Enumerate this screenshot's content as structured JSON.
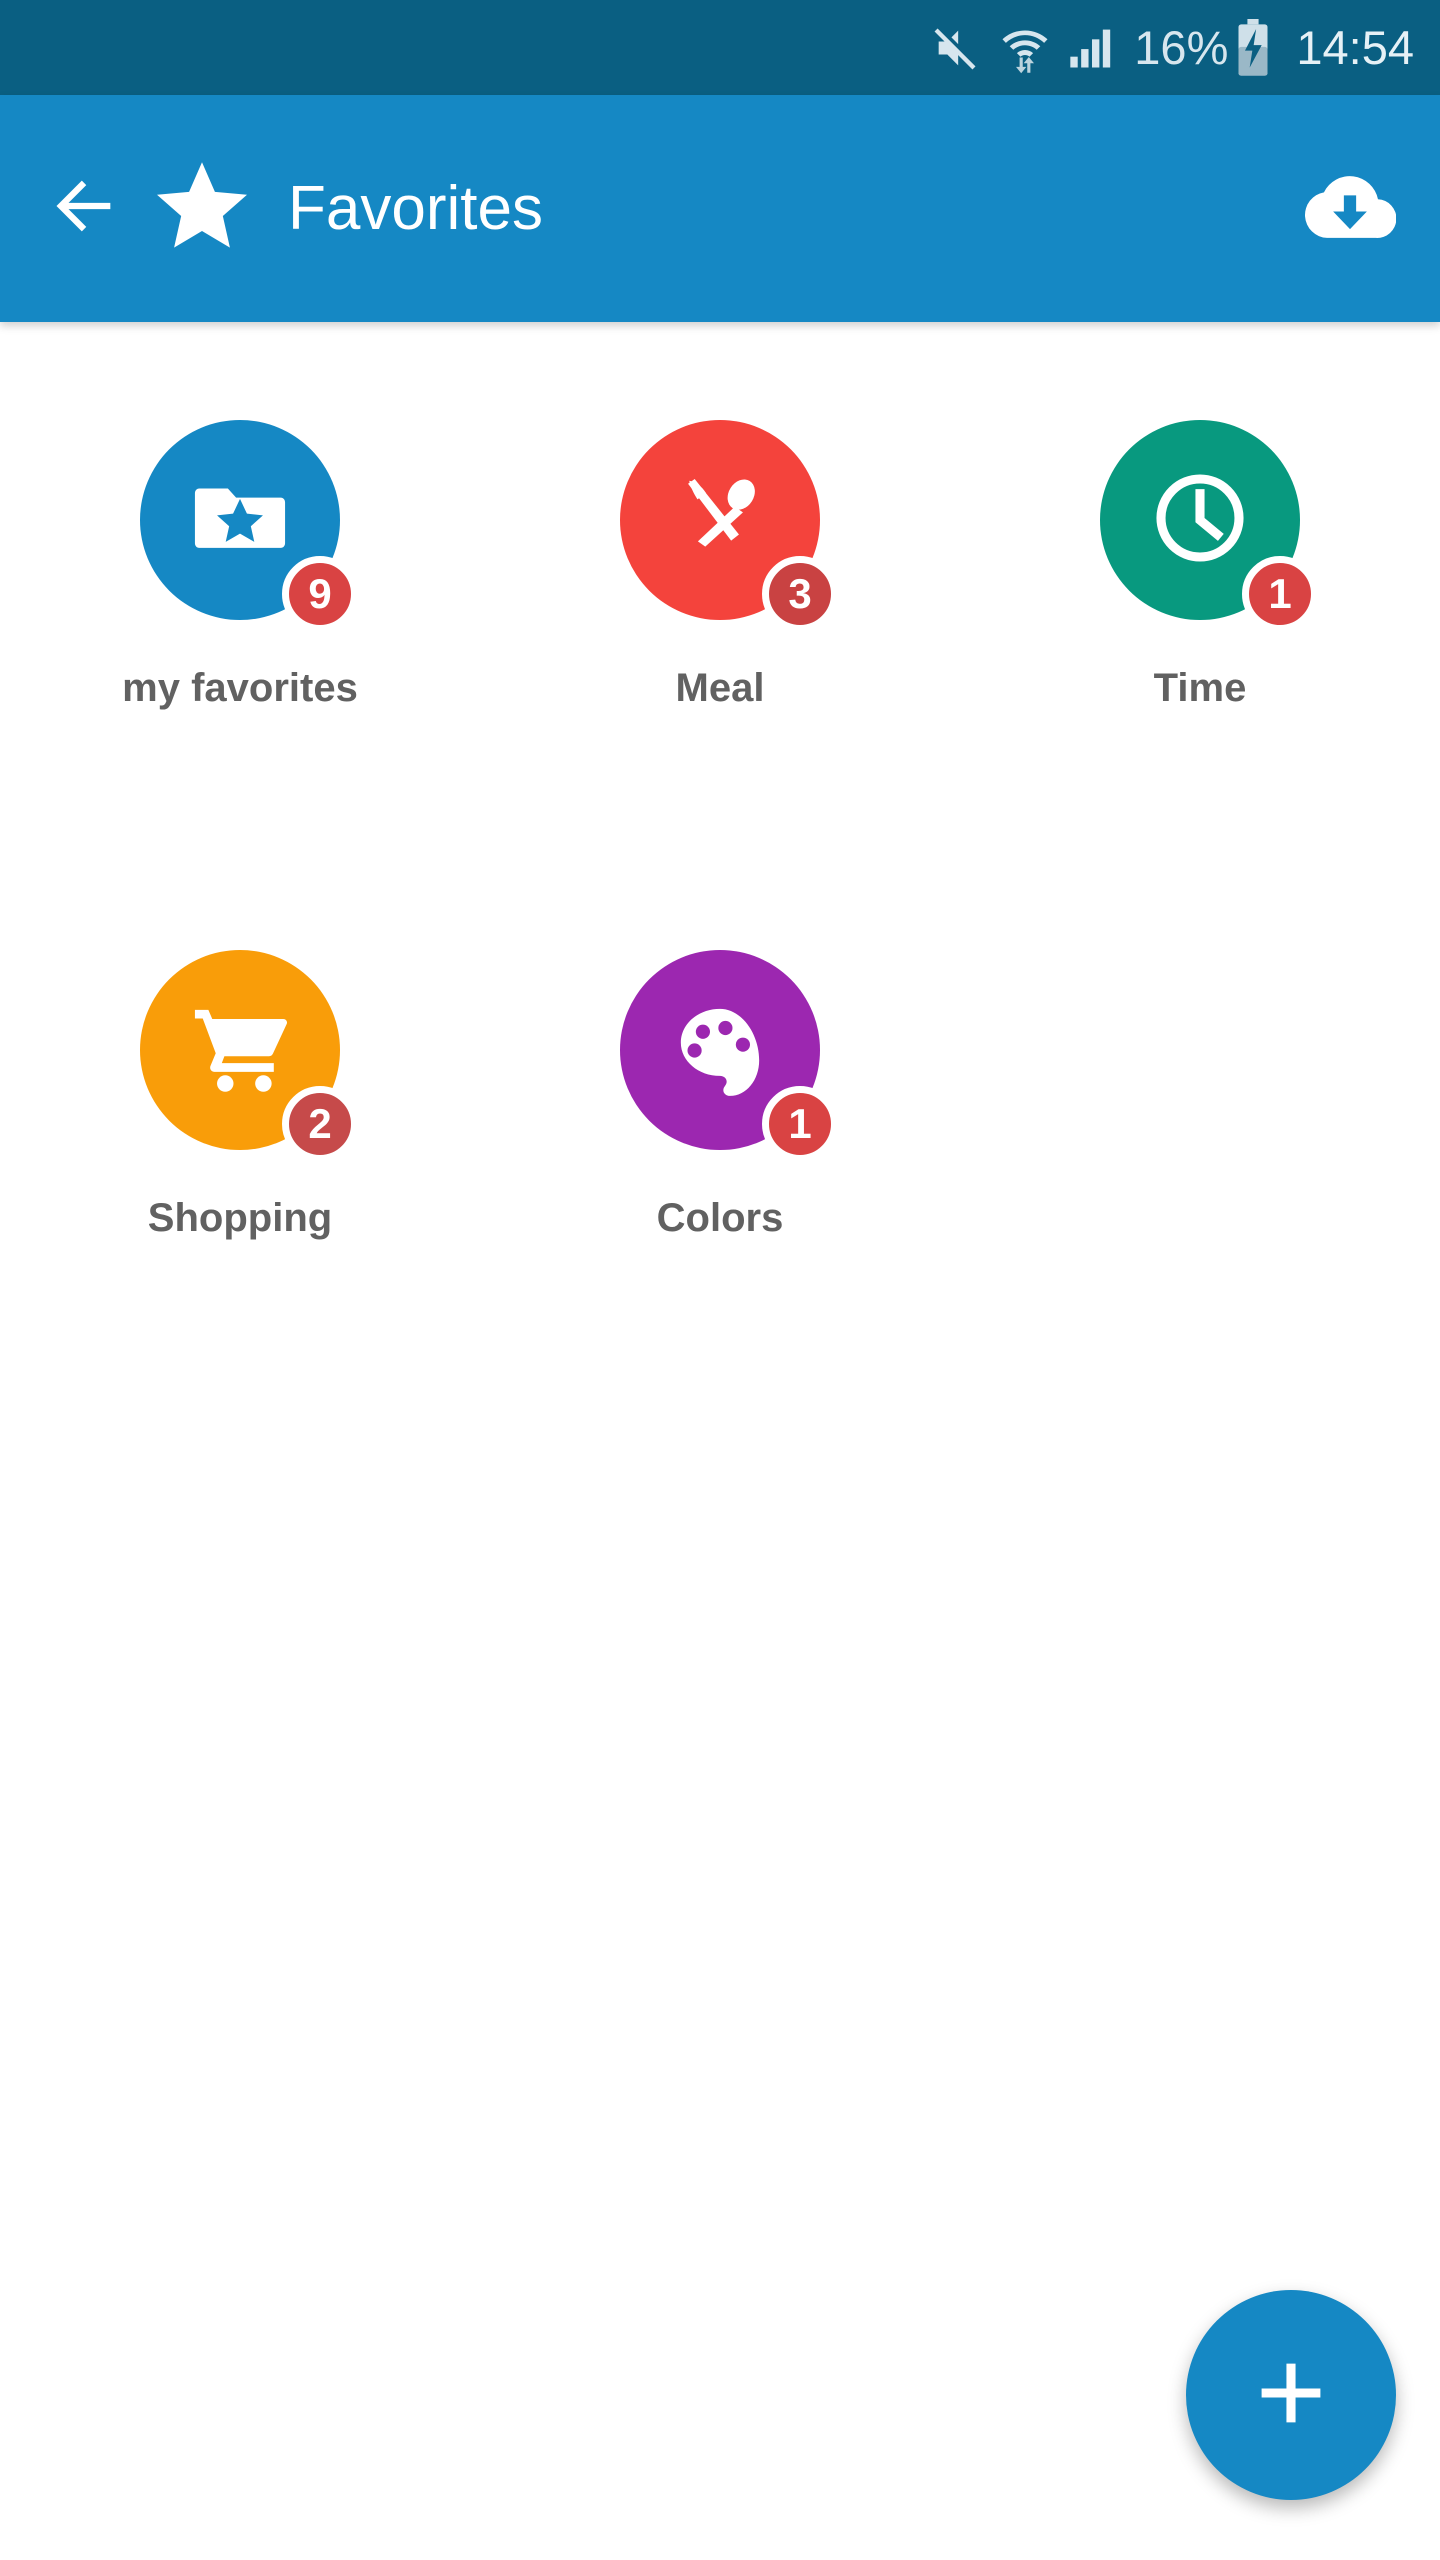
{
  "status_bar": {
    "background": "#0a5f82",
    "mute_icon": "mute-icon",
    "wifi_icon": "wifi-transfer-icon",
    "signal_icon": "cellular-signal-icon",
    "battery_percent": "16%",
    "battery_icon": "battery-charging-icon",
    "clock": "14:54"
  },
  "app_bar": {
    "background": "#1588c4",
    "back_icon": "back-arrow-icon",
    "logo_icon": "star-icon",
    "title": "Favorites",
    "action_icon": "cloud-download-icon"
  },
  "categories": [
    {
      "label": "my favorites",
      "badge": "9",
      "color": "#1588c4",
      "icon": "folder-star-icon"
    },
    {
      "label": "Meal",
      "badge": "3",
      "color": "#f4433c",
      "icon": "knife-spoon-icon"
    },
    {
      "label": "Time",
      "badge": "1",
      "color": "#08997f",
      "icon": "clock-icon"
    },
    {
      "label": "Shopping",
      "badge": "2",
      "color": "#f99d09",
      "icon": "shopping-cart-icon"
    },
    {
      "label": "Colors",
      "badge": "1",
      "color": "#9c27b0",
      "icon": "paint-palette-icon"
    }
  ],
  "fab": {
    "label": "+",
    "icon": "plus-icon",
    "color": "#1588c4"
  },
  "theme": {
    "badge_color": "#d94343",
    "label_color": "#616161",
    "page_background": "#ffffff"
  }
}
